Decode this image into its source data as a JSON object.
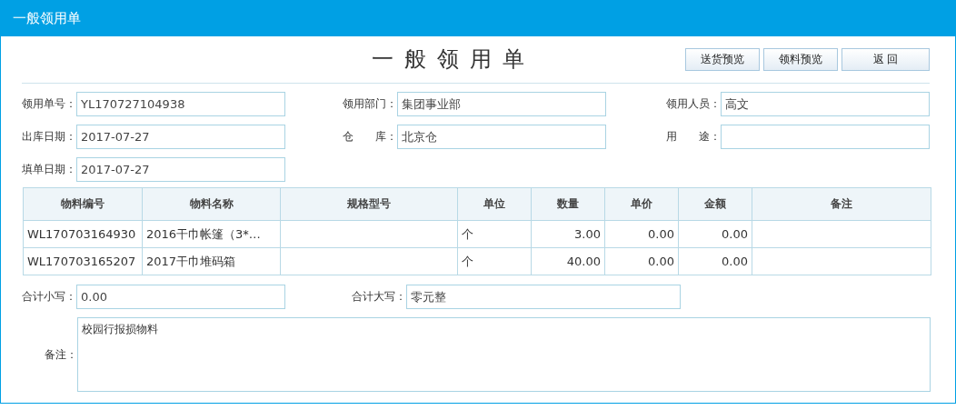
{
  "window": {
    "title": "一般领用单"
  },
  "form_title": "一般领用单",
  "buttons": [
    {
      "label": "送货预览"
    },
    {
      "label": "领料预览"
    },
    {
      "label": "返 回"
    }
  ],
  "fields": [
    {
      "label": "领用单号：",
      "value": "YL170727104938"
    },
    {
      "label": "领用部门：",
      "value": "集团事业部"
    },
    {
      "label": "领用人员：",
      "value": "高文"
    },
    {
      "label": "出库日期：",
      "value": "2017-07-27"
    },
    {
      "label": "仓　　库：",
      "value": "北京仓"
    },
    {
      "label": "用　　途："
    },
    {
      "label": "填单日期：",
      "value": "2017-07-27"
    }
  ],
  "table": {
    "columns": [
      "物料编号",
      "物料名称",
      "规格型号",
      "单位",
      "数量",
      "单价",
      "金额",
      "备注"
    ],
    "rows": [
      [
        "WL170703164930",
        "2016干巾帐篷（3*…",
        "",
        "个",
        "3.00",
        "0.00",
        "0.00",
        ""
      ],
      [
        "WL170703165207",
        "2017干巾堆码箱",
        "",
        "个",
        "40.00",
        "0.00",
        "0.00",
        ""
      ]
    ]
  },
  "totals": [
    {
      "label": "合计小写：",
      "value": "0.00"
    },
    {
      "label": "合计大写：",
      "value": "零元整"
    }
  ],
  "remarks": {
    "label": "备注：",
    "value": "校园行报损物料"
  }
}
